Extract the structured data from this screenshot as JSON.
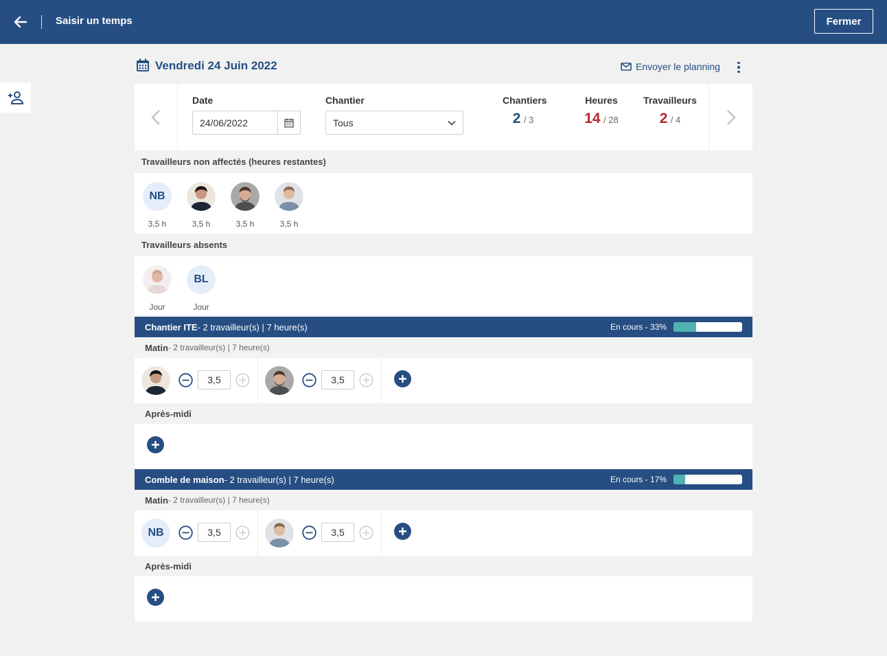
{
  "header": {
    "title": "Saisir un temps",
    "close_label": "Fermer"
  },
  "day": {
    "title": "Vendredi 24 Juin 2022",
    "send_label": "Envoyer le planning"
  },
  "filters": {
    "date_label": "Date",
    "date_value": "24/06/2022",
    "site_label": "Chantier",
    "site_value": "Tous"
  },
  "stats": {
    "sites": {
      "label": "Chantiers",
      "value": "2",
      "total": "/ 3"
    },
    "hours": {
      "label": "Heures",
      "value": "14",
      "total": "/ 28"
    },
    "workers": {
      "label": "Travailleurs",
      "value": "2",
      "total": "/ 4"
    }
  },
  "unassigned": {
    "title": "Travailleurs non affectés (heures restantes)",
    "workers": [
      {
        "initials": "NB",
        "caption": "3,5 h"
      },
      {
        "initials": "",
        "caption": "3,5 h"
      },
      {
        "initials": "",
        "caption": "3,5 h"
      },
      {
        "initials": "",
        "caption": "3,5 h"
      }
    ]
  },
  "absent": {
    "title": "Travailleurs absents",
    "workers": [
      {
        "initials": "",
        "caption": "Jour"
      },
      {
        "initials": "BL",
        "caption": "Jour"
      }
    ]
  },
  "sites": [
    {
      "name": "Chantier ITE",
      "summary": " - 2 travailleur(s) | 7 heure(s)",
      "status": "En cours - 33%",
      "progress": 0.33,
      "morning": {
        "label": "Matin",
        "summary": " - 2 travailleur(s) | 7 heure(s)",
        "entries": [
          {
            "initials": "",
            "hours": "3,5"
          },
          {
            "initials": "",
            "hours": "3,5"
          }
        ]
      },
      "afternoon": {
        "label": "Après-midi"
      }
    },
    {
      "name": "Comble de maison",
      "summary": " - 2 travailleur(s) | 7 heure(s)",
      "status": "En cours - 17%",
      "progress": 0.17,
      "morning": {
        "label": "Matin",
        "summary": " - 2 travailleur(s) | 7 heure(s)",
        "entries": [
          {
            "initials": "NB",
            "hours": "3,5"
          },
          {
            "initials": "",
            "hours": "3,5"
          }
        ]
      },
      "afternoon": {
        "label": "Après-midi"
      }
    }
  ],
  "colors": {
    "primary": "#264e82",
    "alert": "#b7262e",
    "progress": "#4fb3b2"
  }
}
